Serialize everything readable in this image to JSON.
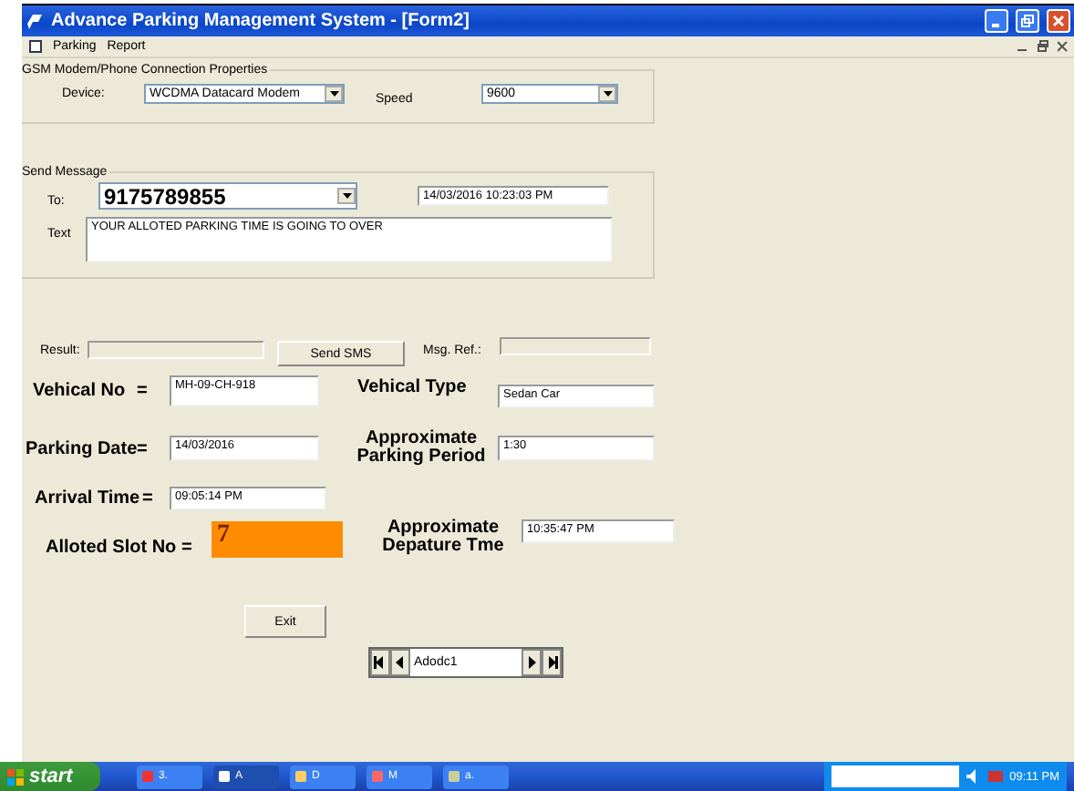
{
  "window": {
    "title": "Advance Parking Management System - [Form2]"
  },
  "menu": [
    "Parking",
    "Report"
  ],
  "gsm": {
    "title": "GSM Modem/Phone Connection Properties",
    "device": {
      "label": "Device:",
      "value": "WCDMA Datacard Modem"
    },
    "speed": {
      "label": "Speed",
      "value": "9600"
    }
  },
  "send_message": {
    "title": "Send Message",
    "to": {
      "label": "To:",
      "value": "9175789855"
    },
    "datetime": "14/03/2016 10:23:03 PM",
    "text": {
      "label": "Text",
      "value": "YOUR ALLOTED PARKING TIME IS GOING TO OVER"
    }
  },
  "result": {
    "label": "Result:"
  },
  "send_button": "Send SMS",
  "msg_ref": {
    "label": "Msg. Ref.:"
  },
  "vehicle_no": {
    "label": "Vehical No",
    "sep": "=",
    "value": "MH-09-CH-918"
  },
  "vehicle_type": {
    "label": "Vehical Type",
    "value": "Sedan Car"
  },
  "parking_date": {
    "label": "Parking Date",
    "sep": "=",
    "value": "14/03/2016"
  },
  "parking_period": {
    "label": "Approximate Parking Period",
    "value": "1:30"
  },
  "arrival_time": {
    "label": "Arrival Time",
    "sep": "=",
    "value": "09:05:14 PM"
  },
  "slot": {
    "label": "Alloted Slot No =",
    "value": "7"
  },
  "departure": {
    "label": "Approximate Depature Tme",
    "value": "10:35:47 PM"
  },
  "exit_button": "Exit",
  "navigator": {
    "caption": "Adodc1"
  },
  "taskbar": {
    "start": "start",
    "tasks": [
      {
        "label": "3.",
        "selected": false
      },
      {
        "label": "A",
        "selected": true
      },
      {
        "label": "D",
        "selected": false
      },
      {
        "label": "M",
        "selected": false
      },
      {
        "label": "a.",
        "selected": false
      }
    ],
    "clock": "09:11 PM"
  }
}
